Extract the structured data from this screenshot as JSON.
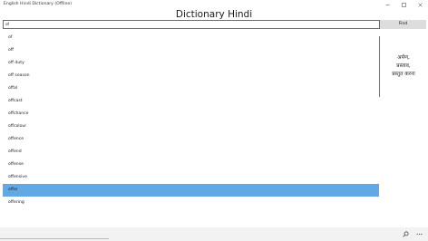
{
  "window": {
    "title": "English Hindi Dictionary (Offline)"
  },
  "header": {
    "title": "Dictionary Hindi"
  },
  "search": {
    "value": "of",
    "find_label": "Find"
  },
  "word_list": {
    "items": [
      "of",
      "off",
      "off duty",
      "off season",
      "offal",
      "offcast",
      "offchance",
      "offcolour",
      "offence",
      "offend",
      "offense",
      "offensive",
      "offer",
      "offering"
    ],
    "selected_index": 12
  },
  "meaning": {
    "lines": [
      "अर्पण,",
      "प्रस्ताव,",
      "प्रस्तुत करना"
    ]
  },
  "colors": {
    "selection": "#62a8e5",
    "find_button": "#dddddd",
    "bottom_bar": "#f2f2f2"
  },
  "icons": {
    "bottom_left": "search-icon",
    "bottom_right": "more-icon"
  }
}
